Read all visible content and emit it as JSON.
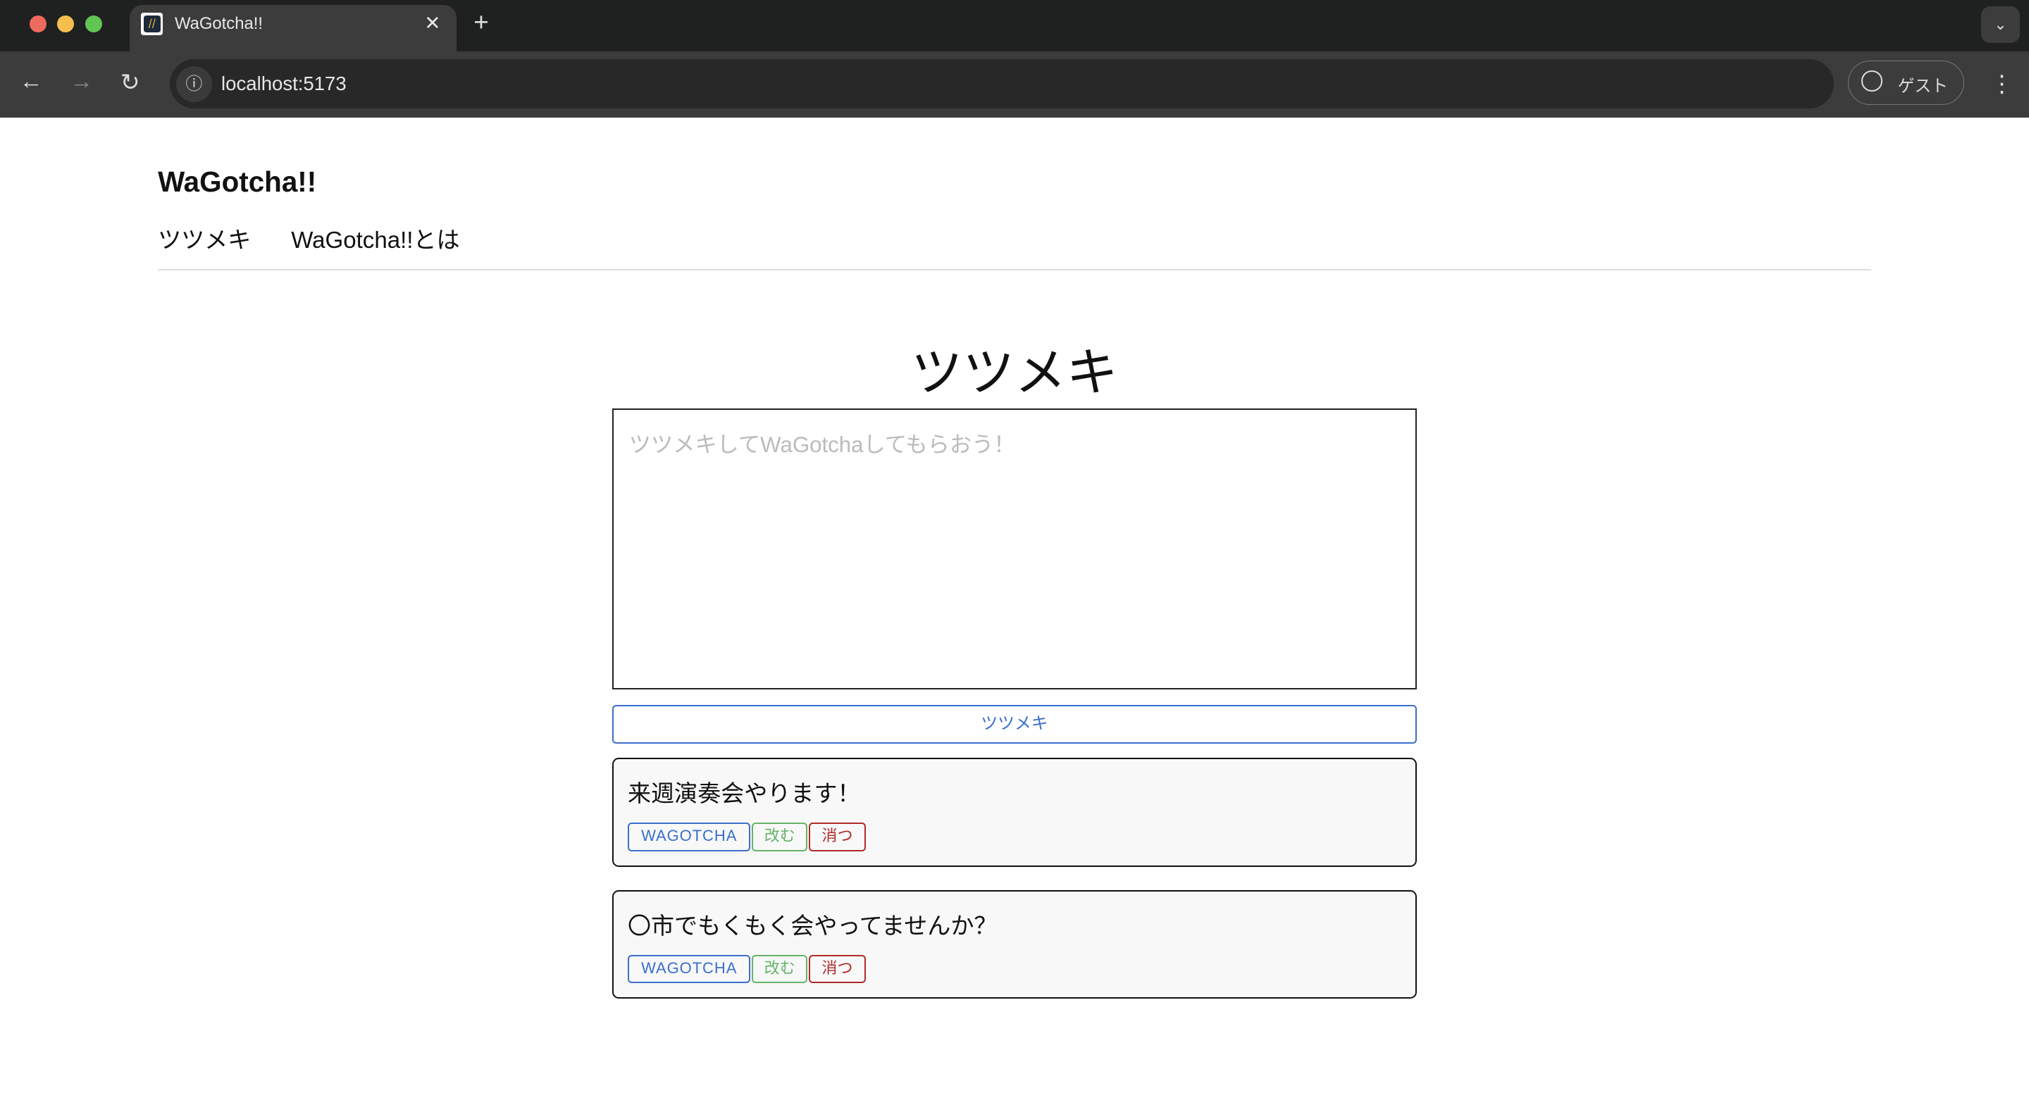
{
  "browser": {
    "tab_title": "WaGotcha!!",
    "url": "localhost:5173",
    "profile_label": "ゲスト"
  },
  "colors": {
    "primary": "#3a6fcc",
    "edit": "#66b366",
    "delete": "#b02a2a"
  },
  "header": {
    "brand": "WaGotcha!!",
    "nav": [
      "ツツメキ",
      "WaGotcha!!とは"
    ]
  },
  "main": {
    "heading": "ツツメキ",
    "textarea_placeholder": "ツツメキしてWaGotchaしてもらおう！",
    "submit_label": "ツツメキ",
    "posts": [
      {
        "text": "来週演奏会やります！",
        "wagotcha": "WAGOTCHA",
        "edit": "改む",
        "delete": "消つ"
      },
      {
        "text": "〇市でもくもく会やってませんか？",
        "wagotcha": "WAGOTCHA",
        "edit": "改む",
        "delete": "消つ"
      }
    ]
  }
}
